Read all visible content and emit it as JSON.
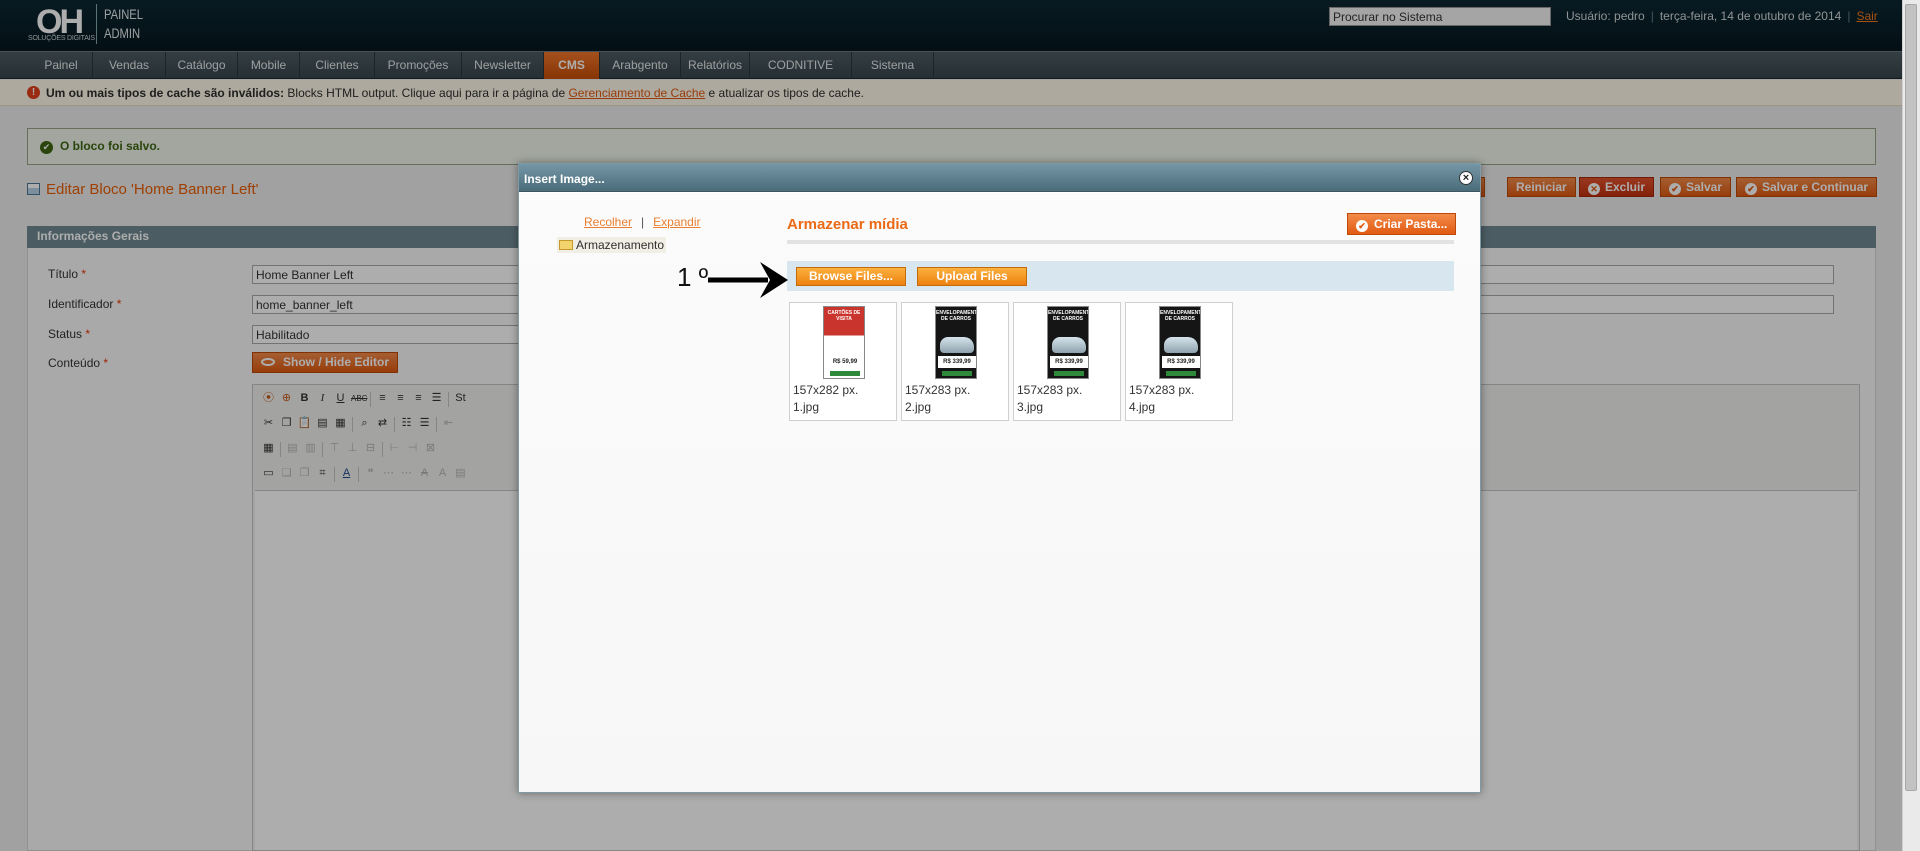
{
  "header": {
    "logo_main": "OH",
    "logo_sub": "SOLUÇÕES DIGITAIS",
    "logo_panel_line1": "PAINEL",
    "logo_panel_line2": "ADMIN",
    "search_placeholder": "Procurar no Sistema",
    "user_label": "Usuário: pedro",
    "date": "terça-feira, 14 de outubro de 2014",
    "logout": "Sair"
  },
  "nav": {
    "items": [
      "Painel",
      "Vendas",
      "Catálogo",
      "Mobile",
      "Clientes",
      "Promoções",
      "Newsletter",
      "CMS",
      "Arabgento",
      "Relatórios",
      "CODNITIVE",
      "Sistema"
    ],
    "active": "CMS"
  },
  "notice": {
    "bold": "Um ou mais tipos de cache são inválidos:",
    "text1": " Blocks HTML output. Clique aqui para ir a página de ",
    "link": "Gerenciamento de Cache",
    "text2": " e atualizar os tipos de cache."
  },
  "success": {
    "message": "O bloco foi salvo."
  },
  "page": {
    "title": "Editar Bloco 'Home Banner Left'",
    "buttons": {
      "back_partial": "ar",
      "reset": "Reiniciar",
      "delete": "Excluir",
      "save": "Salvar",
      "save_continue": "Salvar e Continuar"
    }
  },
  "form": {
    "section_title": "Informações Gerais",
    "fields": {
      "title_label": "Título",
      "title_value": "Home Banner Left",
      "identifier_label": "Identificador",
      "identifier_value": "home_banner_left",
      "status_label": "Status",
      "status_value": "Habilitado",
      "content_label": "Conteúdo",
      "required_mark": "*"
    },
    "show_hide_editor": "Show / Hide Editor",
    "editor_toolbar_partial": "St"
  },
  "dialog": {
    "title": "Insert Image...",
    "close": "×",
    "tree": {
      "collapse": "Recolher",
      "separator": "|",
      "expand": "Expandir",
      "root": "Armazenamento"
    },
    "media_title": "Armazenar mídia",
    "create_folder": "Criar Pasta...",
    "browse_files": "Browse Files...",
    "upload_files": "Upload Files",
    "files": [
      {
        "dims": "157x282 px.",
        "name": "1.jpg",
        "headline": "CARTÕES DE VISITA",
        "price": "R$ 59,99"
      },
      {
        "dims": "157x283 px.",
        "name": "2.jpg",
        "headline": "ENVELOPAMENTO DE CARROS",
        "price": "R$ 339,99"
      },
      {
        "dims": "157x283 px.",
        "name": "3.jpg",
        "headline": "ENVELOPAMENTO DE CARROS",
        "price": "R$ 339,99"
      },
      {
        "dims": "157x283 px.",
        "name": "4.jpg",
        "headline": "ENVELOPAMENTO DE CARROS",
        "price": "R$ 339,99"
      }
    ]
  },
  "annotation": {
    "step": "1 º",
    "icon": "arrow-right-icon"
  },
  "colors": {
    "accent": "#eb6a15",
    "header_bg": "#0d2733",
    "success": "#3d6611",
    "dialog_bar": "#5e8191"
  }
}
